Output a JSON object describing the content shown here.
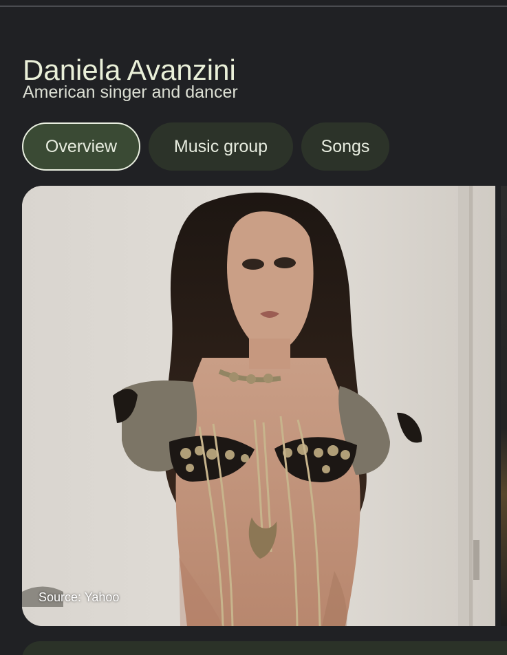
{
  "header": {
    "title": "Daniela Avanzini",
    "subtitle": "American singer and dancer"
  },
  "tabs": [
    {
      "label": "Overview",
      "selected": true
    },
    {
      "label": "Music group",
      "selected": false
    },
    {
      "label": "Songs",
      "selected": false
    }
  ],
  "image_card": {
    "source_label": "Source: Yahoo"
  },
  "colors": {
    "background": "#202124",
    "selected_chip": "#3a4a34",
    "chip": "#2c3329",
    "title": "#eaf0d9"
  }
}
